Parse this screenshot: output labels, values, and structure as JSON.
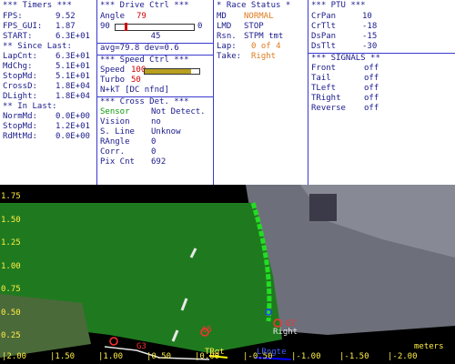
{
  "timers": {
    "header": "*** Timers ***",
    "fps_label": "FPS:",
    "fps": "9.52",
    "fpsgui_label": "FPS_GUI:",
    "fpsgui": "1.87",
    "start_label": "START:",
    "start": "6.3E+01",
    "since_header": "** Since Last:",
    "lapcnt_label": "LapCnt:",
    "lapcnt": "6.3E+01",
    "mdchg_label": "MdChg:",
    "mdchg": "5.1E+01",
    "stopmd_label": "StopMd:",
    "stopmd": "5.1E+01",
    "crossd_label": "CrossD:",
    "crossd": "1.8E+04",
    "dlight_label": "DLight:",
    "dlight": "1.8E+04",
    "inlast_header": "** In Last:",
    "normmd_label": "NormMd:",
    "normmd": "0.0E+00",
    "stopmd2_label": "StopMd:",
    "stopmd2": "1.2E+01",
    "rdmtmd_label": "RdMtMd:",
    "rdmtmd": "0.0E+00"
  },
  "drive": {
    "header": "***  Drive Ctrl  ***",
    "angle_label": "Angle",
    "angle": "79",
    "slider_min": "90",
    "slider_max": "0",
    "slider_mid": "45",
    "slider_fraction": 0.12,
    "avg_text": "avg=79.8  dev=0.6",
    "speed_header": "***  Speed Ctrl  ***",
    "speed_label": "Speed",
    "speed": "100",
    "speed_fraction": 0.85,
    "turbo_label": "Turbo",
    "turbo": "50",
    "nkt_text": "N+kT [DC nfnd]",
    "cross_header": "*** Cross Det. ***",
    "sensor_label": "Sensor",
    "sensor": "Not Detect.",
    "vision_label": "Vision",
    "vision": "no",
    "sline_label": "S. Line",
    "sline": "Unknow",
    "rangle_label": "RAngle",
    "rangle": "0",
    "corr_label": "Corr.",
    "corr": "0",
    "pixcnt_label": "Pix Cnt",
    "pixcnt": "692"
  },
  "race": {
    "header": "* Race Status *",
    "md_label": "MD",
    "md": "NORMAL",
    "lmd_label": "LMD",
    "lmd": "STOP",
    "rsn_label": "Rsn.",
    "rsn": "STPM tmt",
    "lap_label": "Lap:",
    "lap": "0 of 4",
    "take_label": "Take:",
    "take": "Right"
  },
  "ptu": {
    "header": "*** PTU ***",
    "crpan_label": "CrPan",
    "crpan": "10",
    "crtilt_label": "CrTlt",
    "crtilt": "-18",
    "dspan_label": "DsPan",
    "dspan": "-15",
    "dstilt_label": "DsTlt",
    "dstilt": "-30",
    "signals_header": "*** SIGNALS **",
    "front_label": "Front",
    "front": "off",
    "tail_label": "Tail",
    "tail": "off",
    "tleft_label": "TLeft",
    "tleft": "off",
    "tright_label": "TRight",
    "tright": "off",
    "reverse_label": "Reverse",
    "reverse": "off"
  },
  "view": {
    "y_ticks": [
      "1.75",
      "1.50",
      "1.25",
      "1.00",
      "0.75",
      "0.50",
      "0.25"
    ],
    "x_ticks": [
      "2.00",
      "1.50",
      "1.00",
      "0.50",
      "0.00",
      "-0.50",
      "-1.00",
      "-1.50",
      "-2.00"
    ],
    "units": "meters",
    "label_right": "Right",
    "label_g7": "G7",
    "label_g5": "G5",
    "label_g3": "G3",
    "label_trgt": "TRgt",
    "label_lrgt": "LRngte",
    "colors": {
      "track": "#1f7a1f",
      "edge": "#22dd22",
      "axis_text": "#ffee44"
    }
  }
}
